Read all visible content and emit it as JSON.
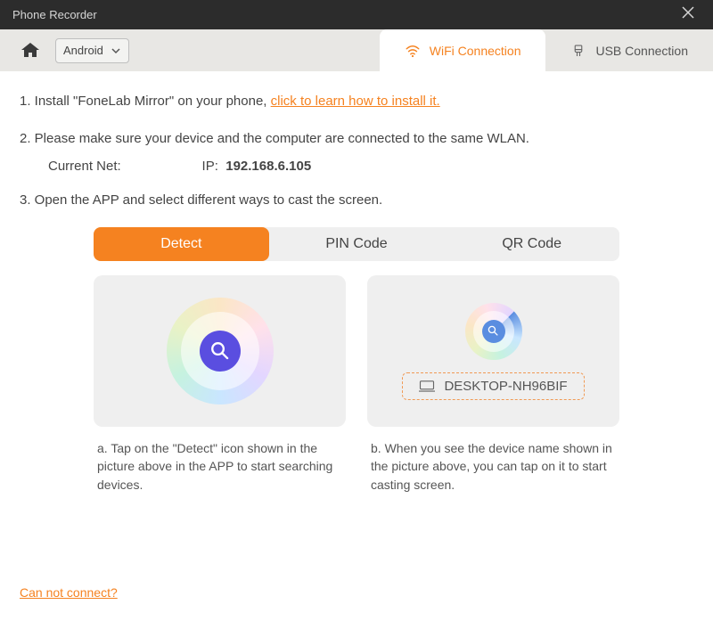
{
  "window": {
    "title": "Phone Recorder"
  },
  "toolbar": {
    "platform_label": "Android",
    "tabs": {
      "wifi": "WiFi Connection",
      "usb": "USB Connection"
    }
  },
  "steps": {
    "s1_prefix": "1. Install \"FoneLab Mirror\" on your phone, ",
    "s1_link": "click to learn how to install it.",
    "s2": "2. Please make sure your device and the computer are connected to the same WLAN.",
    "net_label": "Current Net:",
    "net_value": "",
    "ip_label": "IP:",
    "ip_value": "192.168.6.105",
    "s3": "3. Open the APP and select different ways to cast the screen."
  },
  "cast_tabs": {
    "detect": "Detect",
    "pin": "PIN Code",
    "qr": "QR Code"
  },
  "cards": {
    "device_name": "DESKTOP-NH96BIF",
    "caption_a": "a. Tap on the \"Detect\" icon shown in the picture above in the APP to start searching devices.",
    "caption_b": "b. When you see the device name shown in the picture above, you can tap on it to start casting screen."
  },
  "footer": {
    "help_link": "Can not connect?"
  }
}
